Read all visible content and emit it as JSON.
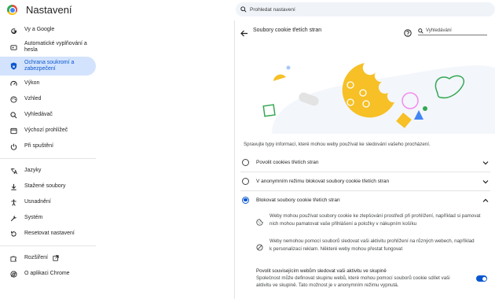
{
  "app": {
    "title": "Nastavení"
  },
  "search": {
    "placeholder": "Prohledat nastavení"
  },
  "sidebar": {
    "items": [
      {
        "label": "Vy a Google",
        "icon": "google-g-icon"
      },
      {
        "label": "Automatické vyplňování a hesla",
        "icon": "autofill-icon"
      },
      {
        "label": "Ochrana soukromí a zabezpečení",
        "icon": "shield-icon",
        "active": true
      },
      {
        "label": "Výkon",
        "icon": "speedometer-icon"
      },
      {
        "label": "Vzhled",
        "icon": "palette-icon"
      },
      {
        "label": "Vyhledávač",
        "icon": "search-icon"
      },
      {
        "label": "Výchozí prohlížeč",
        "icon": "browser-icon"
      },
      {
        "label": "Při spuštění",
        "icon": "power-icon"
      },
      {
        "label": "Jazyky",
        "icon": "translate-icon"
      },
      {
        "label": "Stažené soubory",
        "icon": "download-icon"
      },
      {
        "label": "Usnadnění",
        "icon": "accessibility-icon"
      },
      {
        "label": "Systém",
        "icon": "wrench-icon"
      },
      {
        "label": "Resetovat nastavení",
        "icon": "reset-icon"
      },
      {
        "label": "Rozšíření",
        "icon": "puzzle-icon"
      },
      {
        "label": "O aplikaci Chrome",
        "icon": "chrome-icon"
      }
    ]
  },
  "panel": {
    "title": "Soubory cookie třetích stran",
    "search_placeholder": "Vyhledávání",
    "description": "Spravujte typy informací, které mohou weby používat ke sledování vašeho procházení.",
    "options": [
      {
        "label": "Povolit cookies třetích stran",
        "selected": false
      },
      {
        "label": "V anonymním režimu blokovat soubory cookie třetích stran",
        "selected": false
      },
      {
        "label": "Blokovat soubory cookie třetích stran",
        "selected": true
      }
    ],
    "details": [
      {
        "icon": "cookie-icon",
        "line1": "Weby mohou používat soubory cookie ke zlepšování prostředí při prohlížení, například si pamovat",
        "line2": "nich mohou pamatovat vaše přihlášení a položky v nákupním košíku"
      },
      {
        "icon": "block-icon",
        "line1": "Weby nemohou pomocí souborů sledovat vaši aktivitu prohlížení na různých webech, například",
        "line2": "k personalizaci reklam. Některé weby mohou přestat fungovat"
      }
    ],
    "toggle": {
      "title": "Povolit souvisejícím webům sledovat vaši aktivitu ve skupině",
      "desc1": "Společnost může definovat skupinu webů, které mohou pomocí souborů cookie sdílet vaši",
      "desc2": "aktivitu ve skupině. Tato možnost je v anonymním režimu vypnutá.",
      "on": true
    }
  },
  "colors": {
    "accent": "#0b57d0",
    "active_bg": "#d3e3fd",
    "cookie": "#f6c026"
  }
}
